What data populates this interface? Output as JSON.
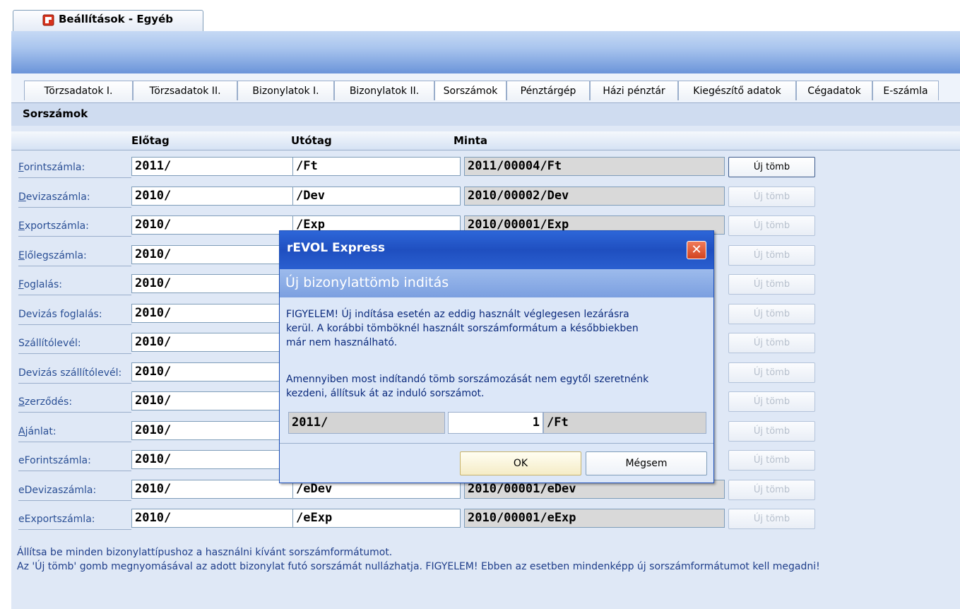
{
  "window_tab": {
    "title": "Beállítások - Egyéb"
  },
  "tabs": [
    {
      "label": "Törzsadatok I."
    },
    {
      "label": "Törzsadatok II."
    },
    {
      "label": "Bizonylatok I."
    },
    {
      "label": "Bizonylatok II."
    },
    {
      "label": "Sorszámok"
    },
    {
      "label": "Pénztárgép"
    },
    {
      "label": "Házi pénztár"
    },
    {
      "label": "Kiegészítő adatok"
    },
    {
      "label": "Cégadatok"
    },
    {
      "label": "E-számla"
    }
  ],
  "section": {
    "title": "Sorszámok"
  },
  "columns": {
    "prefix": "Előtag",
    "suffix": "Utótag",
    "sample": "Minta"
  },
  "rows": [
    {
      "ul": "F",
      "rest": "orintszámla:",
      "prefix": "2011/",
      "suffix": "/Ft",
      "sample": "2011/00004/Ft",
      "button": "Új tömb"
    },
    {
      "ul": "D",
      "rest": "evizaszámla:",
      "prefix": "2010/",
      "suffix": "/Dev",
      "sample": "2010/00002/Dev",
      "button": "Új tömb"
    },
    {
      "ul": "E",
      "rest": "xportszámla:",
      "prefix": "2010/",
      "suffix": "/Exp",
      "sample": "2010/00001/Exp",
      "button": "Új tömb"
    },
    {
      "ul": "E",
      "rest": "lőlegszámla:",
      "prefix": "2010/",
      "suffix": "",
      "sample": "",
      "button": "Új tömb"
    },
    {
      "ul": "F",
      "rest": "oglalás:",
      "prefix": "2010/",
      "suffix": "",
      "sample": "",
      "button": "Új tömb"
    },
    {
      "ul": "",
      "rest": "Devizás foglalás:",
      "prefix": "2010/",
      "suffix": "",
      "sample": "",
      "button": "Új tömb"
    },
    {
      "ul": "",
      "rest": "Szállítólevél:",
      "prefix": "2010/",
      "suffix": "",
      "sample": "",
      "button": "Új tömb"
    },
    {
      "ul": "",
      "rest": "Devizás szállítólevél:",
      "prefix": "2010/",
      "suffix": "",
      "sample": "",
      "button": "Új tömb"
    },
    {
      "ul": "S",
      "rest": "zerződés:",
      "prefix": "2010/",
      "suffix": "",
      "sample": "",
      "button": "Új tömb"
    },
    {
      "ul": "A",
      "rest": "jánlat:",
      "prefix": "2010/",
      "suffix": "",
      "sample": "",
      "button": "Új tömb"
    },
    {
      "ul": "",
      "rest": "eForintszámla:",
      "prefix": "2010/",
      "suffix": "",
      "sample": "",
      "button": "Új tömb"
    },
    {
      "ul": "",
      "rest": "eDevizaszámla:",
      "prefix": "2010/",
      "suffix": "/eDev",
      "sample": "2010/00001/eDev",
      "button": "Új tömb"
    },
    {
      "ul": "",
      "rest": "eExportszámla:",
      "prefix": "2010/",
      "suffix": "/eExp",
      "sample": "2010/00001/eExp",
      "button": "Új tömb"
    }
  ],
  "help": {
    "line1": "Állítsa be minden bizonylattípushoz a használni kívánt sorszámformátumot.",
    "line2": "Az 'Új tömb' gomb megnyomásával az adott bizonylat futó sorszámát nullázhatja. FIGYELEM! Ebben az esetben mindenképp új sorszámformátumot kell megadni!"
  },
  "dialog": {
    "title": "rEVOL Express",
    "close_glyph": "✕",
    "header": "Új bizonylattömb inditás",
    "warning_lines": [
      "FIGYELEM! Új indítása esetén az eddig használt véglegesen lezárásra",
      "kerül. A korábbi tömböknél használt sorszámformátum a későbbiekben",
      "már nem használható."
    ],
    "info_lines": [
      "Amennyiben most indítandó tömb sorszámozását nem egytől szeretnénk",
      "kezdeni, állítsuk át az induló sorszámot."
    ],
    "prefix": "2011/",
    "start_number": "1",
    "suffix": "/Ft",
    "ok_label": "OK",
    "cancel_label": "Mégsem"
  }
}
